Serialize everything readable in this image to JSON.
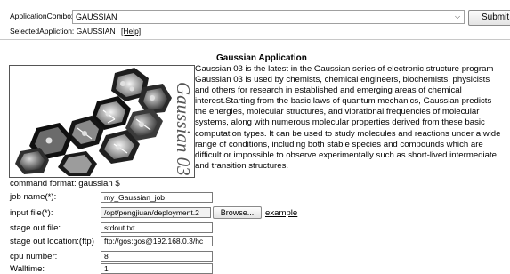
{
  "top_bar": {
    "app_combobox_label": "ApplicationCombox:",
    "app_combobox_value": "GAUSSIAN",
    "submit_label": "Submit",
    "selected_label": "SelectedAppliction: GAUSSIAN",
    "help_link": "[Help]"
  },
  "app": {
    "title": "Gaussian Application",
    "description": "Gaussian 03 is the latest in the Gaussian series of electronic structure program\nGaussian 03 is used by chemists, chemical engineers, biochemists, physicists\nand others for research in established and emerging areas of chemical\ninterest.Starting from the basic laws of quantum mechanics, Gaussian predicts\nthe energies, molecular structures, and vibrational frequencies of molecular\nsystems, along with numerous molecular properties derived from these basic\ncomputation types. It can be used to study molecules and reactions under a wide\nrange of conditions, including both stable species and compounds which are\ndifficult or impossible to observe experimentally such as short-lived intermediate\nand transition structures.",
    "logo_text": "Gaussian 03"
  },
  "form": {
    "command_format": "command format: gaussian $",
    "fields": [
      {
        "label": "job name(*):",
        "value": "my_Gaussian_job"
      },
      {
        "label": "input file(*):",
        "value": "/opt/pengjiuan/deployment.2"
      },
      {
        "label": "stage out file:",
        "value": "stdout.txt"
      },
      {
        "label": "stage out location:(ftp)",
        "value": "ftp://gos:gos@192.168.0.3/hc"
      },
      {
        "label": "cpu number:",
        "value": "8"
      },
      {
        "label": "Walltime:",
        "value": "1"
      }
    ],
    "browse_label": "Browse...",
    "example_link": "example"
  }
}
